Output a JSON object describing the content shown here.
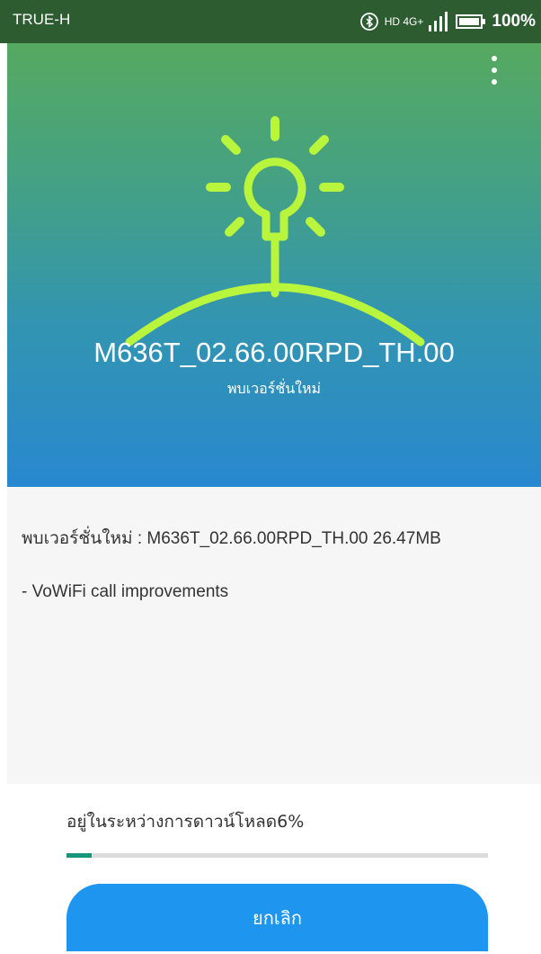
{
  "status_bar": {
    "carrier": "TRUE-H",
    "network": "HD 4G+",
    "battery": "100%",
    "icons": [
      "bluetooth-icon",
      "signal-icon",
      "battery-icon"
    ]
  },
  "header": {
    "menu_icon": "more-vertical-icon",
    "illustration_icon": "lightbulb-icon",
    "model": "M636T_02.66.00RPD_TH.00",
    "subtitle": "พบเวอร์ชั่นใหม่"
  },
  "details": {
    "version_line": "พบเวอร์ชั่นใหม่ : M636T_02.66.00RPD_TH.00  26.47MB",
    "changelog": "- VoWiFi call improvements"
  },
  "progress": {
    "label": "อยู่ในระหว่างการดาวน์โหลด6%",
    "percent": 6
  },
  "actions": {
    "cancel_label": "ยกเลิก"
  },
  "colors": {
    "accent": "#1e96f0",
    "progress": "#14967a",
    "bulb": "#b8f53c"
  }
}
